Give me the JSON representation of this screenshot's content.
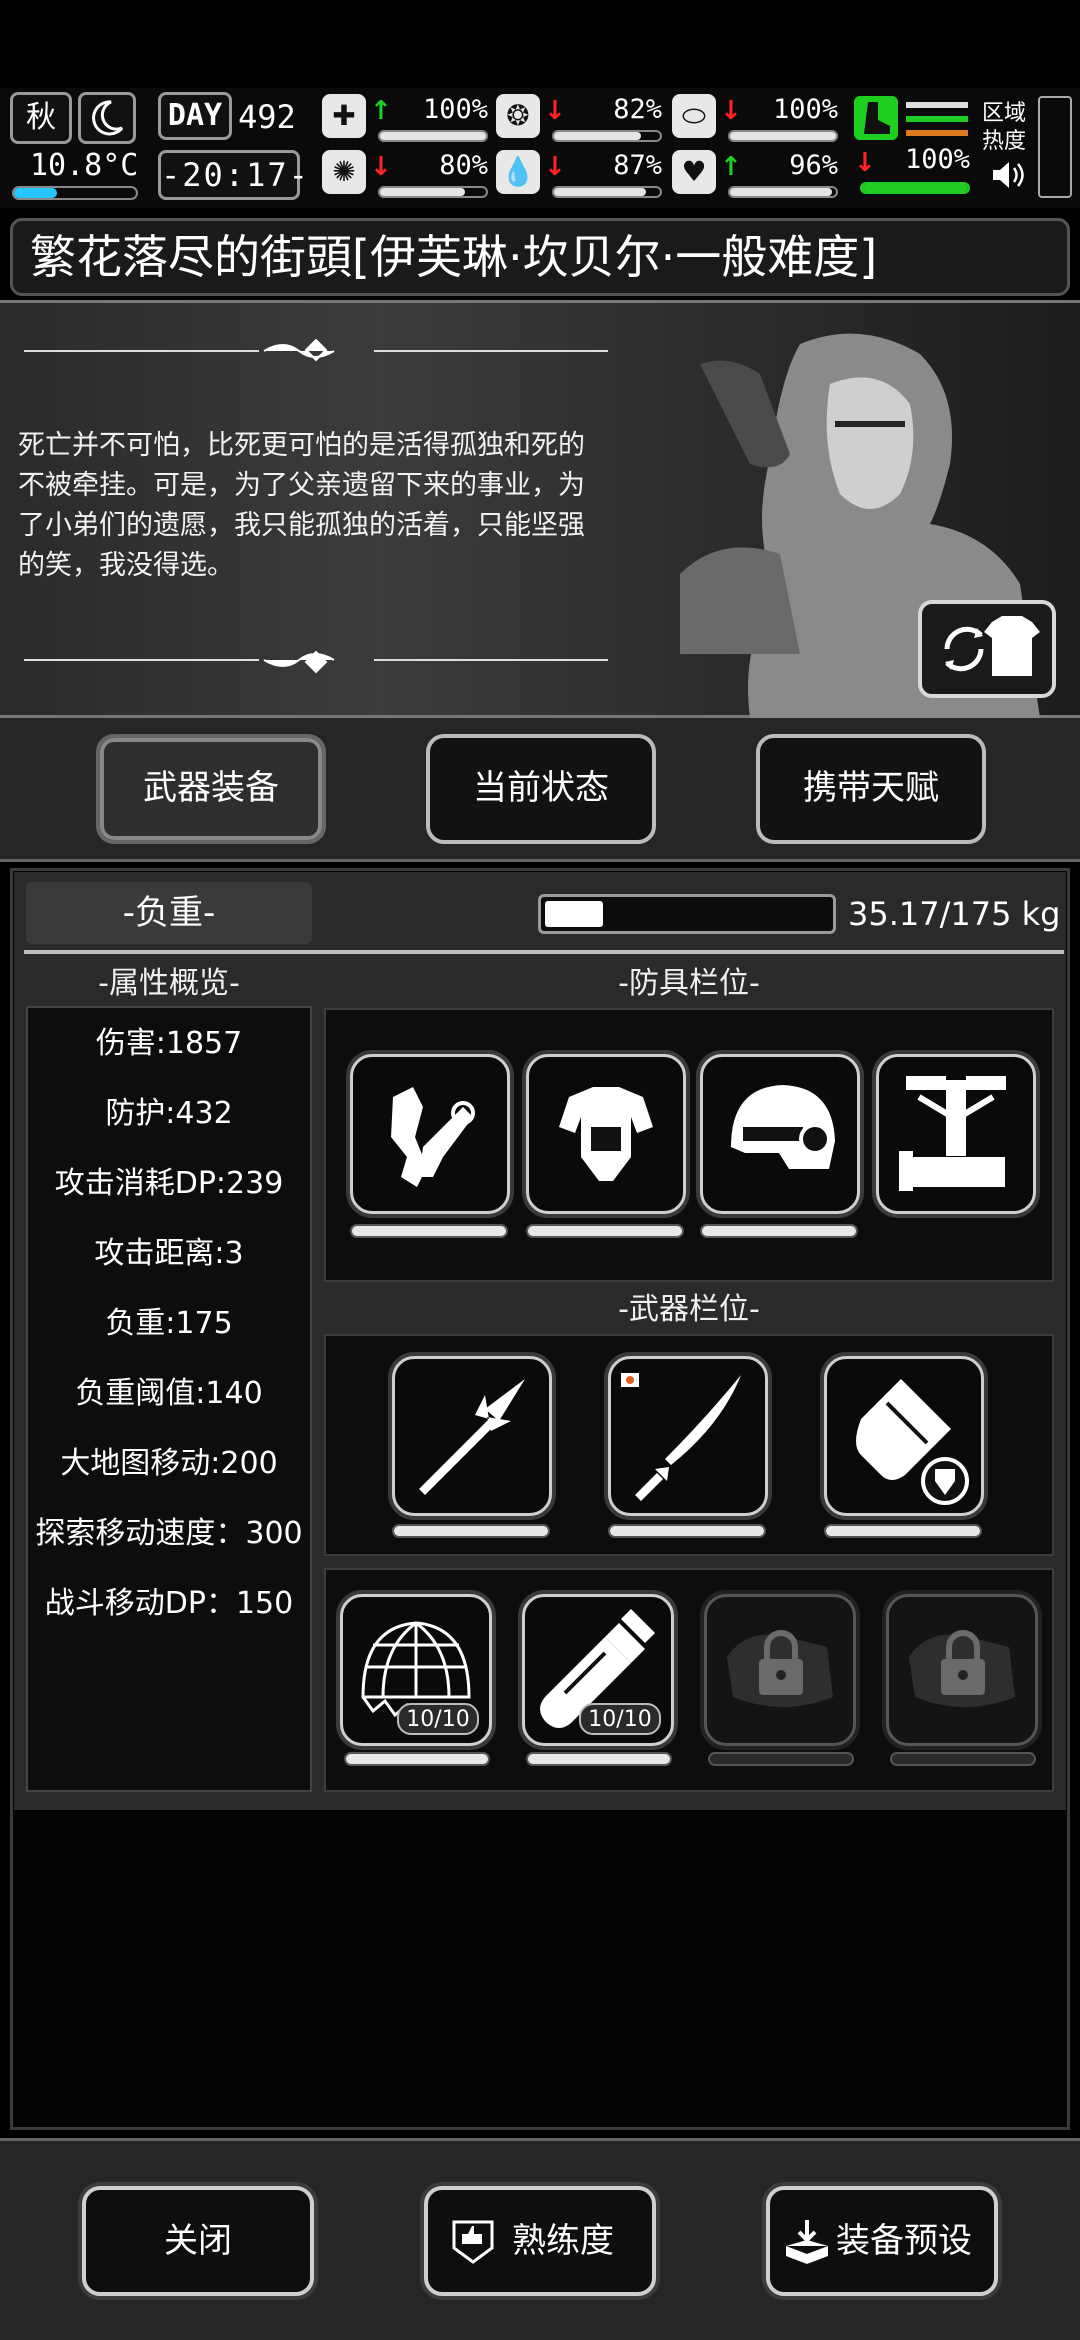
{
  "hud": {
    "season": "秋",
    "temperature": "10.8°C",
    "temperature_level": 0.35,
    "day_badge": "DAY",
    "day_number": "492",
    "clock": "-20:17-",
    "area_label_line1": "区域",
    "area_label_line2": "热度",
    "stats": [
      {
        "icon": "medkit-icon",
        "trend": "up",
        "value": "100%",
        "level": 1.0
      },
      {
        "icon": "stomach-icon",
        "trend": "down",
        "value": "82%",
        "level": 0.82
      },
      {
        "icon": "capsule-icon",
        "trend": "down",
        "value": "100%",
        "level": 1.0
      },
      {
        "icon": "brain-icon",
        "trend": "down",
        "value": "80%",
        "level": 0.8
      },
      {
        "icon": "water-drop-icon",
        "trend": "down",
        "value": "87%",
        "level": 0.87
      },
      {
        "icon": "heart-icon",
        "trend": "up",
        "value": "96%",
        "level": 0.96
      }
    ],
    "stamina": {
      "icon": "boot-icon",
      "trend": "down",
      "value": "100%",
      "level": 1.0
    },
    "colors": {
      "up": "#1fd11f",
      "down": "#ff2323",
      "temp": "#26c6ff",
      "stamina": "#22cc22"
    }
  },
  "title": "繁花落尽的街頭[伊芙琳·坎贝尔·一般难度]",
  "quote": "死亡并不可怕，比死更可怕的是活得孤独和死的不被牵挂。可是，为了父亲遗留下来的事业，为了小弟们的遗愿，我只能孤独的活着，只能坚强的笑，我没得选。",
  "tabs": [
    "武器装备",
    "当前状态",
    "携带天赋"
  ],
  "load": {
    "label": "-负重-",
    "text": "35.17/175 kg",
    "fraction": 0.2
  },
  "attributes": {
    "header": "-属性概览-",
    "items": [
      "伤害:1857",
      "防护:432",
      "攻击消耗DP:239",
      "攻击距离:3",
      "负重:175",
      "负重阈值:140",
      "大地图移动:200",
      "探索移动速度：300",
      "战斗移动DP：150"
    ]
  },
  "armor": {
    "header": "-防具栏位-",
    "slots": [
      {
        "icon": "gloves-armor-icon",
        "durability": 1.0
      },
      {
        "icon": "chest-armor-icon",
        "durability": 1.0
      },
      {
        "icon": "helmet-icon",
        "durability": 1.0
      },
      {
        "icon": "backpack-frame-icon",
        "durability": null
      }
    ]
  },
  "weapons": {
    "header": "-武器栏位-",
    "slots": [
      {
        "icon": "spear-icon",
        "durability": 1.0
      },
      {
        "icon": "katana-icon",
        "durability": 1.0
      },
      {
        "icon": "riot-shield-icon",
        "durability": 1.0
      }
    ]
  },
  "items": {
    "slots": [
      {
        "icon": "net-trap-icon",
        "quantity": "10/10",
        "locked": false
      },
      {
        "icon": "spray-bottle-icon",
        "quantity": "10/10",
        "locked": false
      },
      {
        "icon": "lock-icon",
        "quantity": "",
        "locked": true
      },
      {
        "icon": "lock-icon",
        "quantity": "",
        "locked": true
      }
    ]
  },
  "bottom": {
    "close": "关闭",
    "proficiency": "熟练度",
    "preset": "装备预设"
  }
}
